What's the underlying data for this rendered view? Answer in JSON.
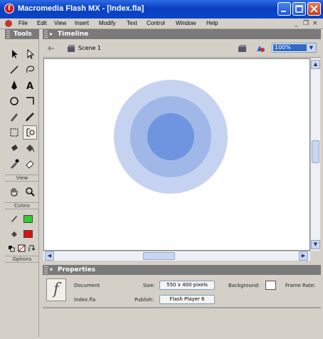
{
  "window": {
    "title": "Macromedia Flash MX - [Index.fla]",
    "app_icon_letter": "f",
    "controls": [
      "minimize",
      "maximize",
      "close"
    ]
  },
  "menu": {
    "items": [
      "File",
      "Edit",
      "View",
      "Insert",
      "Modify",
      "Text",
      "Control",
      "Window",
      "Help"
    ],
    "mdi_controls": [
      "_",
      "❐",
      "×"
    ]
  },
  "tools": {
    "title": "Tools",
    "view_label": "View",
    "colors_label": "Colors",
    "options_label": "Options",
    "stroke_color": "#33cc33",
    "fill_color": "#dd1111"
  },
  "timeline": {
    "title": "Timeline",
    "scene_label": "Scene 1",
    "zoom": "100%"
  },
  "stage": {
    "colors": [
      "#c5d3f0",
      "#9fb8e8",
      "#6f95e0"
    ]
  },
  "properties": {
    "title": "Properties",
    "doc_type": "Document",
    "doc_name": "Index.fla",
    "size_label": "Size:",
    "size_value": "550 x 400 pixels",
    "background_label": "Background:",
    "frame_rate_label": "Frame Rate:",
    "publish_label": "Publish:",
    "publish_value": "Flash Player 6"
  }
}
